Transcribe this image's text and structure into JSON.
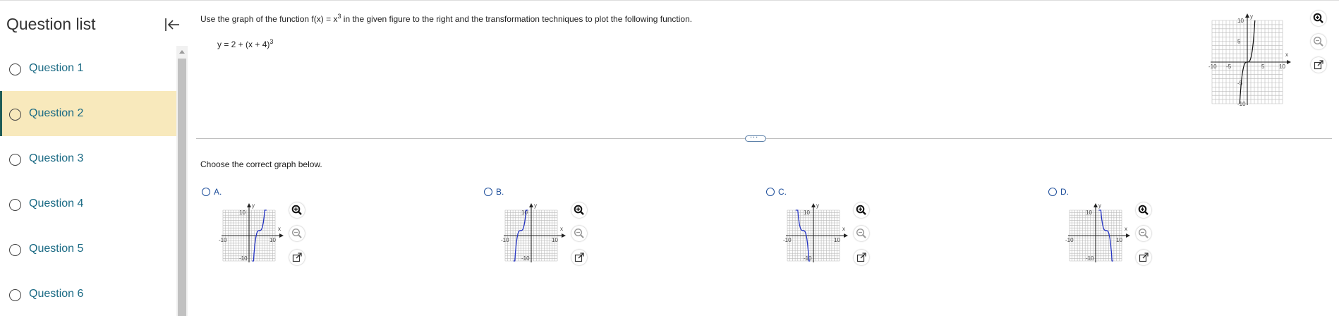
{
  "sidebar": {
    "title": "Question list",
    "collapse_icon": "collapse-left-icon",
    "items": [
      {
        "label": "Question 1",
        "active": false
      },
      {
        "label": "Question 2",
        "active": true
      },
      {
        "label": "Question 3",
        "active": false
      },
      {
        "label": "Question 4",
        "active": false
      },
      {
        "label": "Question 5",
        "active": false
      },
      {
        "label": "Question 6",
        "active": false
      }
    ]
  },
  "question": {
    "text_before": "Use the graph of the function f(x) = x",
    "text_exp": "3",
    "text_after": " in the given figure to the right and the transformation techniques to plot the following function.",
    "function_before": "y = 2 + (x + 4)",
    "function_exp": "3"
  },
  "divider_handle": "...",
  "prompt": "Choose the correct graph below.",
  "choices": [
    {
      "letter": "A.",
      "curve": "increasing",
      "shift_x": 4,
      "shift_y": 2
    },
    {
      "letter": "B.",
      "curve": "increasing",
      "shift_x": -4,
      "shift_y": 2
    },
    {
      "letter": "C.",
      "curve": "decreasing",
      "shift_x": -4,
      "shift_y": 2
    },
    {
      "letter": "D.",
      "curve": "decreasing",
      "shift_x": 4,
      "shift_y": 2
    }
  ],
  "mini_axis": {
    "x_label": "x",
    "y_label": "y",
    "tick_neg": "-10",
    "tick_pos": "10"
  },
  "reference_graph": {
    "x_label": "x",
    "y_label": "y",
    "x_ticks": [
      "-10",
      "-5",
      "5",
      "10"
    ],
    "y_ticks": [
      "10",
      "5",
      "-5",
      "-10"
    ]
  },
  "colors": {
    "curve": "#2433c2",
    "accent": "#1c4d9a",
    "active_bg": "#f8e9bc"
  }
}
